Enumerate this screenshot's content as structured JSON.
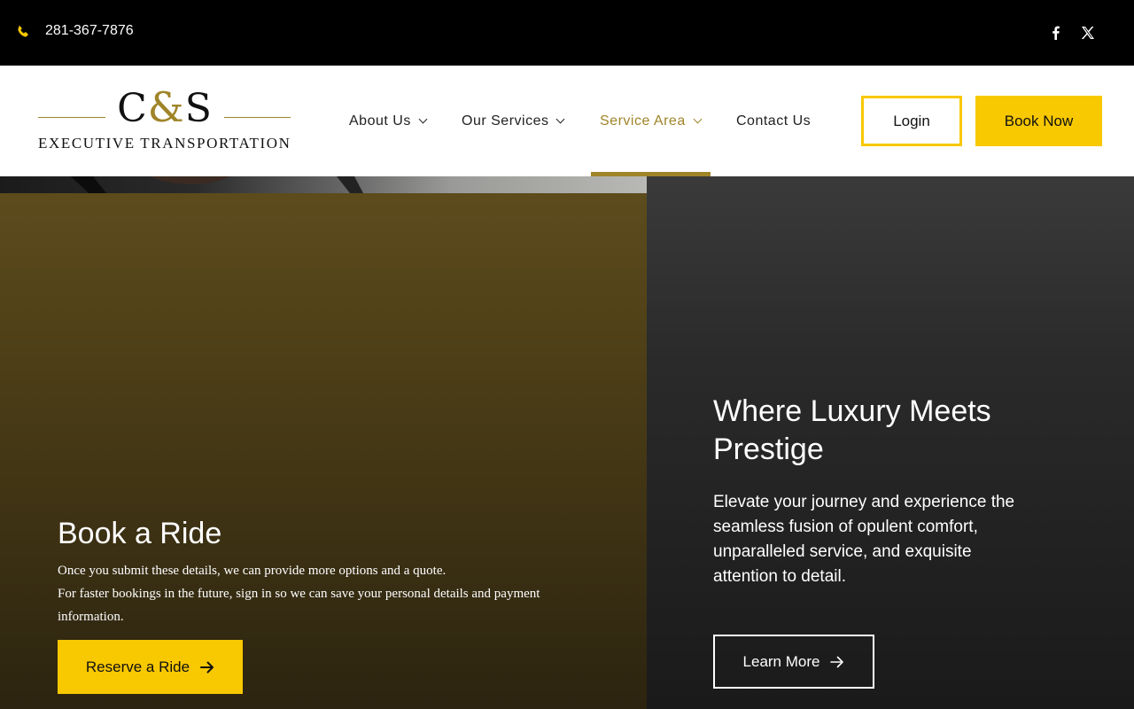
{
  "topbar": {
    "phone": "281-367-7876",
    "phone_icon": "phone-icon",
    "social": [
      "facebook-icon",
      "x-twitter-icon"
    ]
  },
  "logo": {
    "monogram_left": "C",
    "monogram_amp": "&",
    "monogram_right": "S",
    "subtitle": "EXECUTIVE TRANSPORTATION"
  },
  "nav": {
    "items": [
      {
        "label": "About Us",
        "has_dropdown": true
      },
      {
        "label": "Our Services",
        "has_dropdown": true
      },
      {
        "label": "Service Area",
        "has_dropdown": true,
        "active": true
      },
      {
        "label": "Contact Us",
        "has_dropdown": false
      }
    ],
    "login_label": "Login",
    "book_label": "Book Now"
  },
  "hero_left": {
    "title": "Book a Ride",
    "line1": "Once you submit these details, we can provide more options and a quote.",
    "line2": "For faster bookings in the future, sign in so we can save your personal details and payment information.",
    "button_label": "Reserve a Ride"
  },
  "hero_right": {
    "title": "Where Luxury Meets Prestige",
    "text": "Elevate your journey and experience the seamless fusion of opulent comfort, unparalleled service, and exquisite attention to detail.",
    "button_label": "Learn More"
  },
  "colors": {
    "accent_gold": "#a08428",
    "button_yellow": "#f8c800",
    "topbar_bg": "#000000"
  }
}
